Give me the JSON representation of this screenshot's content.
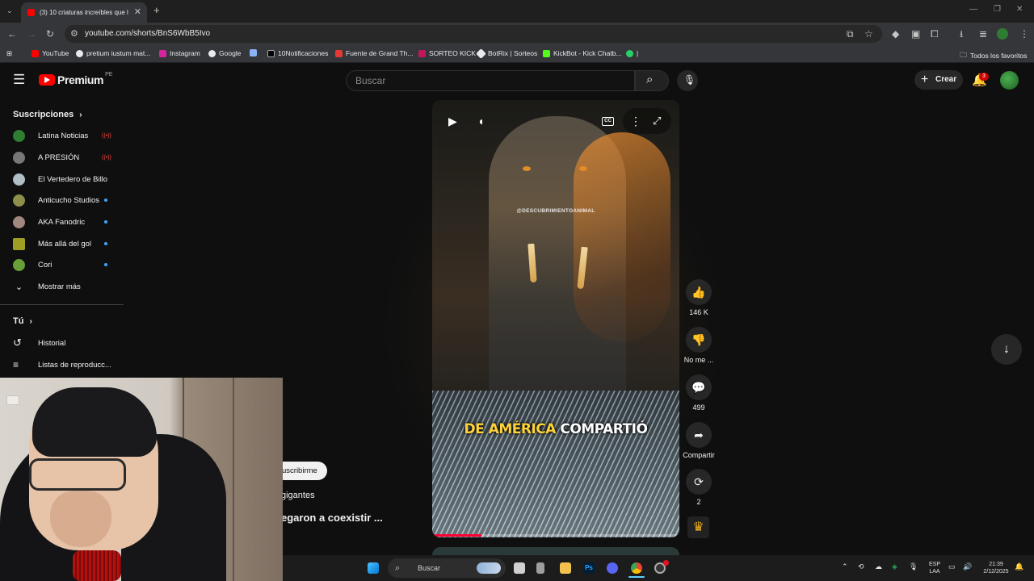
{
  "browser": {
    "tab_title": "(3) 10 criaturas increíbles que ll",
    "url": "youtube.com/shorts/BnS6WbB5Ivo",
    "bookmarks": [
      {
        "label": "YouTube",
        "color": "#ff0000"
      },
      {
        "label": "pretium iustum mat...",
        "color": "#e8eaed"
      },
      {
        "label": "Instagram",
        "color": "#d6249f"
      },
      {
        "label": "Google",
        "color": "#e8eaed"
      },
      {
        "label": "",
        "color": "#8ab4f8"
      },
      {
        "label": "10Notificaciones",
        "color": "#e8eaed"
      },
      {
        "label": "Fuente de Grand Th...",
        "color": "#e53935"
      },
      {
        "label": "SORTEO KICK",
        "color": "#c2185b"
      },
      {
        "label": "BotRix | Sorteos",
        "color": "#e8eaed"
      },
      {
        "label": "KickBot - Kick Chatb...",
        "color": "#53fc18"
      },
      {
        "label": "|",
        "color": "#25d366"
      }
    ],
    "all_bookmarks_label": "Todos los favoritos"
  },
  "youtube": {
    "logo_text": "Premium",
    "logo_region": "PE",
    "search_placeholder": "Buscar",
    "create_label": "Crear",
    "notification_count": "3"
  },
  "sidebar": {
    "subscriptions_heading": "Suscripciones",
    "channels": [
      {
        "name": "Latina Noticias",
        "indicator": "live",
        "avatar_color": "#2e7d32"
      },
      {
        "name": "A PRESIÓN",
        "indicator": "live",
        "avatar_color": "#777777"
      },
      {
        "name": "El Vertedero de Billo",
        "indicator": "none",
        "avatar_color": "#b0bec5"
      },
      {
        "name": "Anticucho Studios",
        "indicator": "dot",
        "avatar_color": "#8d8f4a"
      },
      {
        "name": "AKA Fanodric",
        "indicator": "dot",
        "avatar_color": "#a1887f"
      },
      {
        "name": "Más allá del gol",
        "indicator": "dot",
        "avatar_color": "#9e9d24"
      },
      {
        "name": "Cori",
        "indicator": "dot",
        "avatar_color": "#689f38"
      }
    ],
    "show_more_label": "Mostrar más",
    "you_heading": "Tú",
    "history_label": "Historial",
    "playlists_label": "Listas de reproducc..."
  },
  "short": {
    "watermark": "@DESCUBRIMIENTOANIMAL",
    "caption_highlight": "DE AMÉRICA",
    "caption_rest": "COMPARTIÓ",
    "progress_fraction": 0.2,
    "channel_line": "gigantes",
    "title_line": "egaron a coexistir ...",
    "subscribe_label": "uscribirme"
  },
  "actions": {
    "likes": "146 K",
    "dislike_label": "No me ...",
    "comments": "499",
    "share_label": "Compartir",
    "remix_count": "2"
  },
  "taskbar": {
    "search_label": "Buscar",
    "language": "ESP",
    "layout": "LAA",
    "time": "21:39",
    "date": "2/12/2025"
  }
}
